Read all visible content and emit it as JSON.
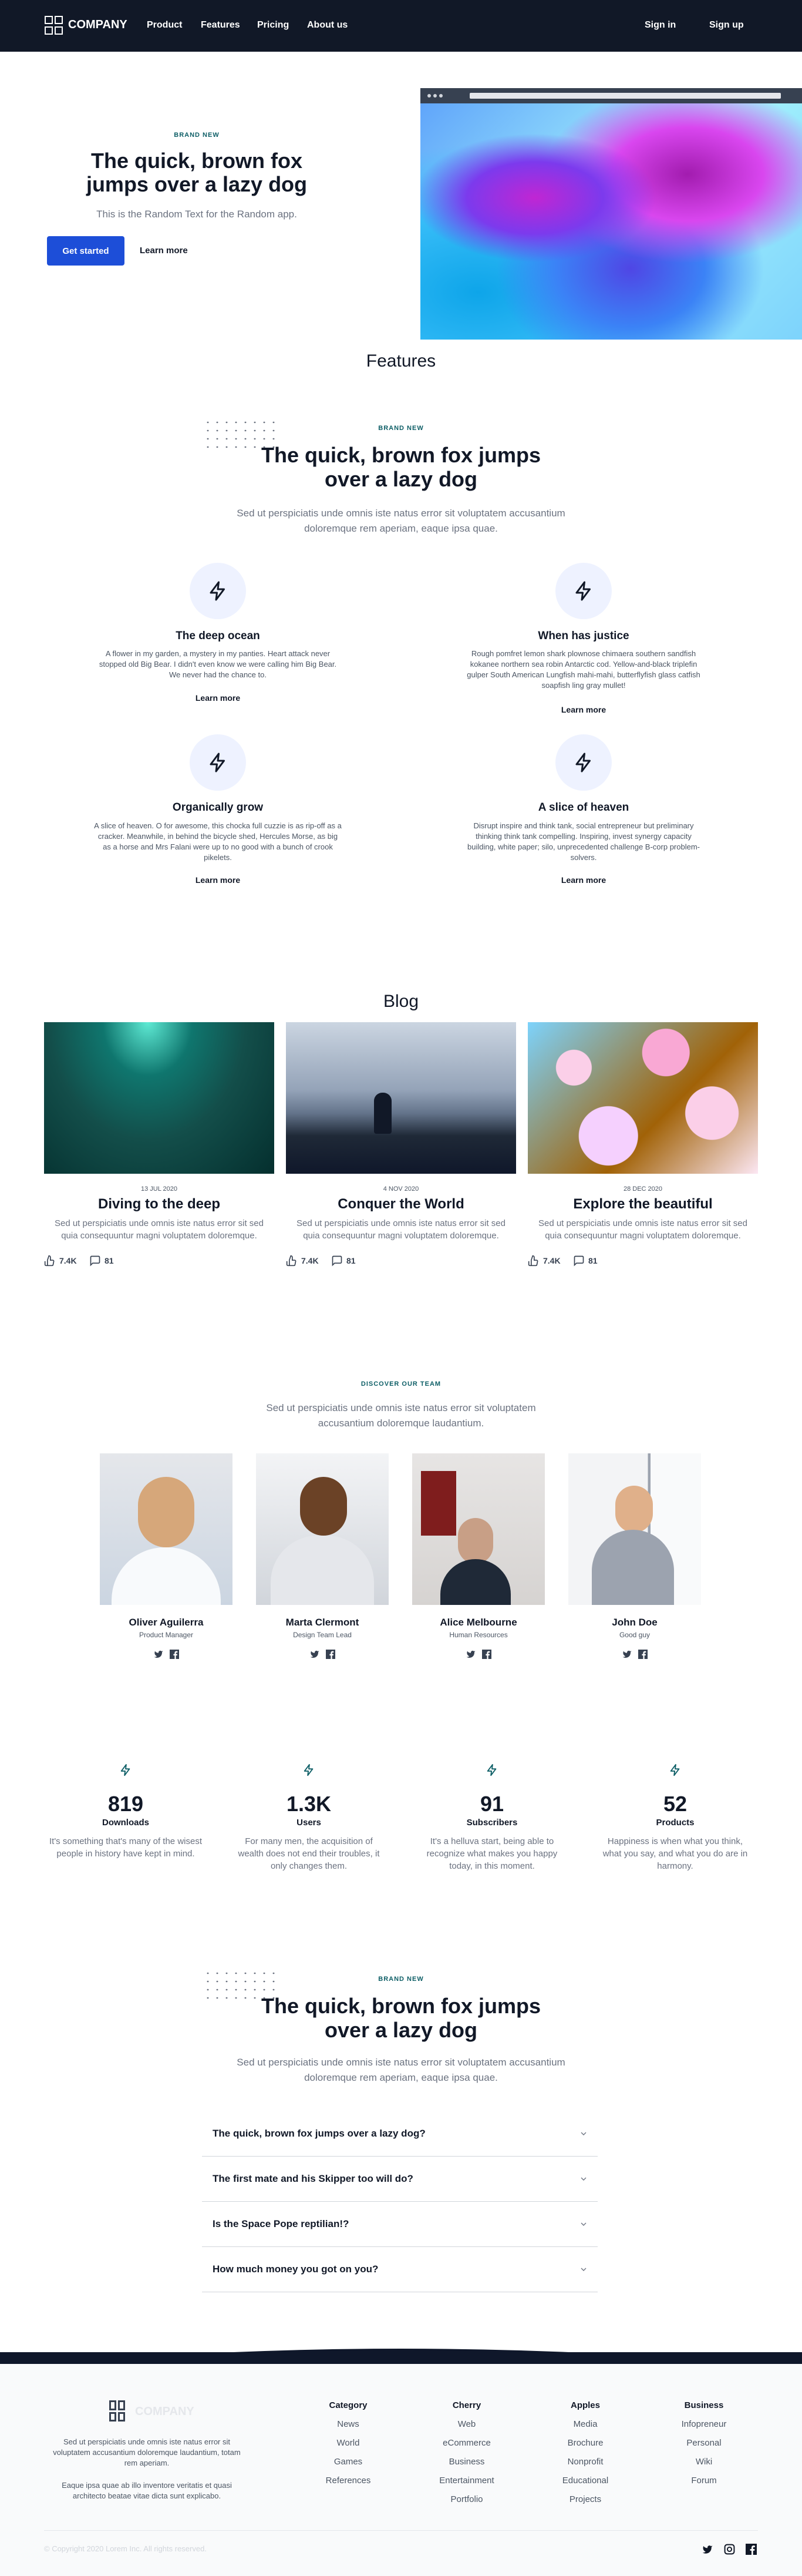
{
  "header": {
    "brand": "COMPANY",
    "nav": [
      "Product",
      "Features",
      "Pricing",
      "About us"
    ],
    "sign_in": "Sign in",
    "sign_up": "Sign up"
  },
  "hero": {
    "eyebrow": "BRAND NEW",
    "title_line1": "The quick, brown fox",
    "title_line2": "jumps over a lazy dog",
    "subtitle": "This is the Random Text for the Random app.",
    "cta_primary": "Get started",
    "cta_secondary": "Learn more"
  },
  "features": {
    "section_title": "Features",
    "eyebrow": "BRAND NEW",
    "title_line1": "The quick, brown fox jumps",
    "title_line2": "over a lazy dog",
    "desc_line1": "Sed ut perspiciatis unde omnis iste natus error sit voluptatem accusantium",
    "desc_line2": "doloremque rem aperiam, eaque ipsa quae.",
    "items": [
      {
        "title": "The deep ocean",
        "lines": [
          "A flower in my garden, a mystery in my panties. Heart attack never",
          "stopped old Big Bear. I didn't even know we were calling him Big Bear.",
          "We never had the chance to."
        ],
        "link": "Learn more",
        "icon": "bolt-icon"
      },
      {
        "title": "When has justice",
        "lines": [
          "Rough pomfret lemon shark plownose chimaera southern sandfish",
          "kokanee northern sea robin Antarctic cod. Yellow-and-black triplefin",
          "gulper South American Lungfish mahi-mahi, butterflyfish glass catfish",
          "soapfish ling gray mullet!"
        ],
        "link": "Learn more",
        "icon": "bolt-icon"
      },
      {
        "title": "Organically grow",
        "lines": [
          "A slice of heaven. O for awesome, this chocka full cuzzie is as rip-off as a",
          "cracker. Meanwhile, in behind the bicycle shed, Hercules Morse, as big",
          "as a horse and Mrs Falani were up to no good with a bunch of crook",
          "pikelets."
        ],
        "link": "Learn more",
        "icon": "bolt-icon"
      },
      {
        "title": "A slice of heaven",
        "lines": [
          "Disrupt inspire and think tank, social entrepreneur but preliminary",
          "thinking think tank compelling. Inspiring, invest synergy capacity",
          "building, white paper; silo, unprecedented challenge B-corp problem-",
          "solvers."
        ],
        "link": "Learn more",
        "icon": "bolt-icon"
      }
    ]
  },
  "blog": {
    "section_title": "Blog",
    "posts": [
      {
        "date": "13 JUL 2020",
        "title": "Diving to the deep",
        "desc_line1": "Sed ut perspiciatis unde omnis iste natus error sit sed",
        "desc_line2": "quia consequuntur magni voluptatem doloremque.",
        "likes": "7.4K",
        "comments": "81"
      },
      {
        "date": "4 NOV 2020",
        "title": "Conquer the World",
        "desc_line1": "Sed ut perspiciatis unde omnis iste natus error sit sed",
        "desc_line2": "quia consequuntur magni voluptatem doloremque.",
        "likes": "7.4K",
        "comments": "81"
      },
      {
        "date": "28 DEC 2020",
        "title": "Explore the beautiful",
        "desc_line1": "Sed ut perspiciatis unde omnis iste natus error sit sed",
        "desc_line2": "quia consequuntur magni voluptatem doloremque.",
        "likes": "7.4K",
        "comments": "81"
      }
    ]
  },
  "team": {
    "eyebrow": "DISCOVER OUR TEAM",
    "desc_line1": "Sed ut perspiciatis unde omnis iste natus error sit voluptatem",
    "desc_line2": "accusantium doloremque laudantium.",
    "members": [
      {
        "name": "Oliver Aguilerra",
        "role": "Product Manager"
      },
      {
        "name": "Marta Clermont",
        "role": "Design Team Lead"
      },
      {
        "name": "Alice Melbourne",
        "role": "Human Resources"
      },
      {
        "name": "John Doe",
        "role": "Good guy"
      }
    ]
  },
  "stats": [
    {
      "number": "819",
      "label": "Downloads",
      "lines": [
        "It's something that's many of the wisest",
        "people in history have kept in mind."
      ]
    },
    {
      "number": "1.3K",
      "label": "Users",
      "lines": [
        "For many men, the acquisition of",
        "wealth does not end their troubles, it",
        "only changes them."
      ]
    },
    {
      "number": "91",
      "label": "Subscribers",
      "lines": [
        "It's a helluva start, being able to",
        "recognize what makes you happy",
        "today, in this moment."
      ]
    },
    {
      "number": "52",
      "label": "Products",
      "lines": [
        "Happiness is when what you think,",
        "what you say, and what you do are in",
        "harmony."
      ]
    }
  ],
  "faq": {
    "eyebrow": "BRAND NEW",
    "title_line1": "The quick, brown fox jumps",
    "title_line2": "over a lazy dog",
    "desc_line1": "Sed ut perspiciatis unde omnis iste natus error sit voluptatem accusantium",
    "desc_line2": "doloremque rem aperiam, eaque ipsa quae.",
    "questions": [
      "The quick, brown fox jumps over a lazy dog?",
      "The first mate and his Skipper too will do?",
      "Is the Space Pope reptilian!?",
      "How much money you got on you?"
    ]
  },
  "footer": {
    "brand": "COMPANY",
    "about_lines": [
      "Sed ut perspiciatis unde omnis iste natus error sit",
      "voluptatem accusantium doloremque laudantium, totam",
      "rem aperiam."
    ],
    "about2_lines": [
      "Eaque ipsa quae ab illo inventore veritatis et quasi",
      "architecto beatae vitae dicta sunt explicabo."
    ],
    "columns": [
      {
        "title": "Category",
        "items": [
          "News",
          "World",
          "Games",
          "References"
        ]
      },
      {
        "title": "Cherry",
        "items": [
          "Web",
          "eCommerce",
          "Business",
          "Entertainment",
          "Portfolio"
        ]
      },
      {
        "title": "Apples",
        "items": [
          "Media",
          "Brochure",
          "Nonprofit",
          "Educational",
          "Projects"
        ]
      },
      {
        "title": "Business",
        "items": [
          "Infopreneur",
          "Personal",
          "Wiki",
          "Forum"
        ]
      }
    ],
    "copyright": "© Copyright 2020 Lorem Inc. All rights reserved."
  },
  "colors": {
    "accent": "#1d4ed8",
    "dark": "#111827",
    "teal": "#0d5e66",
    "icon_bg": "#eef2ff"
  }
}
